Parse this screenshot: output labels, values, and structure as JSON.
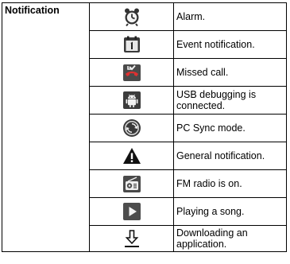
{
  "category_label": "Notification",
  "rows": [
    {
      "icon": "alarm-clock-icon",
      "description": "Alarm."
    },
    {
      "icon": "calendar-event-icon",
      "description": "Event notification."
    },
    {
      "icon": "missed-call-icon",
      "description": "Missed call."
    },
    {
      "icon": "android-usb-debugging-icon",
      "description": "USB debugging is connected."
    },
    {
      "icon": "pc-sync-icon",
      "description": "PC Sync mode."
    },
    {
      "icon": "warning-triangle-icon",
      "description": "General notification."
    },
    {
      "icon": "fm-radio-icon",
      "description": "FM radio is on."
    },
    {
      "icon": "play-icon",
      "description": "Playing a song."
    },
    {
      "icon": "download-icon",
      "description": "Downloading an application."
    }
  ]
}
